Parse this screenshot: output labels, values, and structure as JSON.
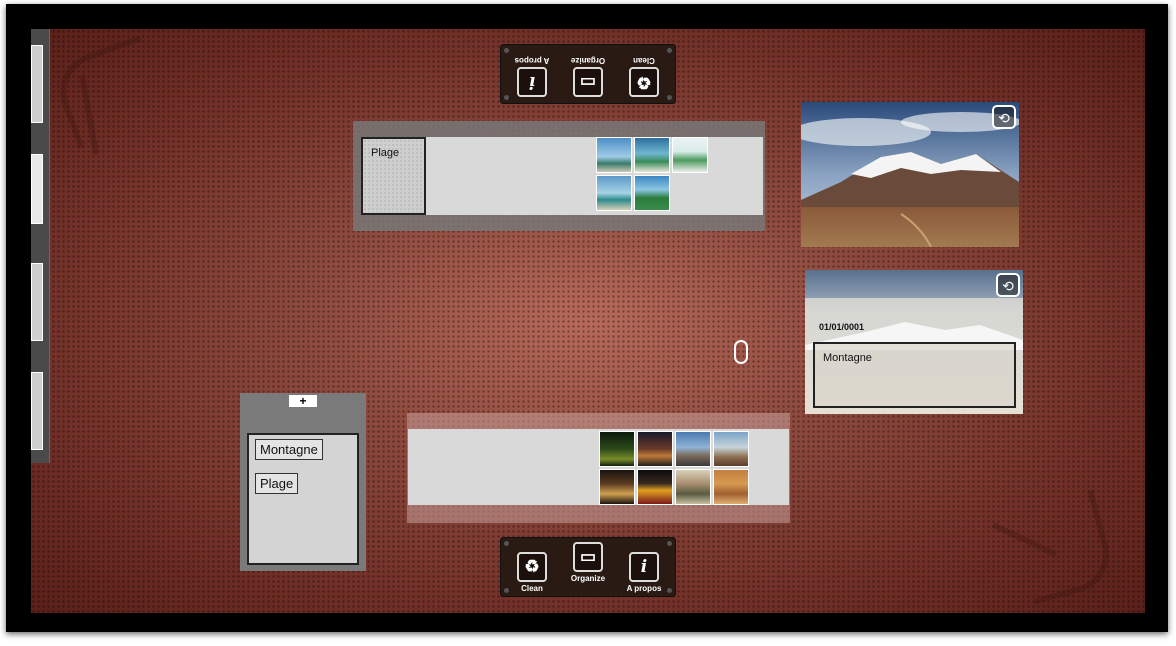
{
  "toolbar_top": {
    "clean_label": "Clean",
    "organize_label": "Organize",
    "about_label": "A propos"
  },
  "toolbar_bottom": {
    "clean_label": "Clean",
    "organize_label": "Organize",
    "about_label": "A propos"
  },
  "bin_plage": {
    "tag_label": "Plage",
    "thumb_count": 5
  },
  "bin_unsorted": {
    "thumb_count": 8
  },
  "photo_card_montagne": {
    "date": "01/01/0001",
    "tag_label": "Montagne"
  },
  "tag_panel": {
    "add_label": "+",
    "tags": [
      "Montagne",
      "Plage"
    ]
  },
  "icons": {
    "clean": "recycle-icon",
    "organize": "folder-icon",
    "about": "info-icon",
    "link": "link-icon"
  },
  "colors": {
    "surface": "#8e4a3e",
    "toolbar": "#2a1a14",
    "bin": "#7a7a7a"
  }
}
